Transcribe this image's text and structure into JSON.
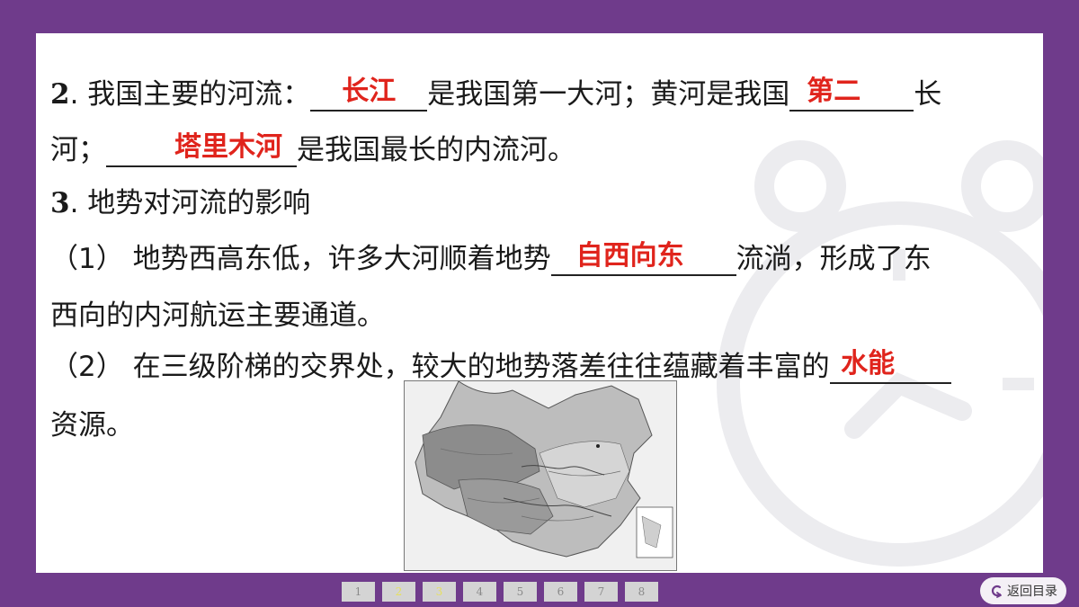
{
  "q2": {
    "num": "2",
    "text1": ". 我国主要的河流：",
    "ans1": "长江",
    "text2": "是我国第一大河；黄河是我国",
    "ans2": "第二",
    "text3": "长",
    "text4": "河；",
    "ans3": "塔里木河",
    "text5": "是我国最长的内流河。"
  },
  "q3": {
    "num": "3",
    "title": ". 地势对河流的影响",
    "p1_label": "（1）",
    "p1_text1": "地势西高东低，许多大河顺着地势",
    "p1_ans": "自西向东",
    "p1_text2": "流淌，形成了东",
    "p1_text3": "西向的内河航运主要通道。",
    "p2_label": "（2）",
    "p2_text1": "在三级阶梯的交界处，较大的地势落差往往蕴藏着丰富的",
    "p2_ans": "水能",
    "p2_text2": "资源。"
  },
  "pagination": {
    "pages": [
      "1",
      "2",
      "3",
      "4",
      "5",
      "6",
      "7",
      "8"
    ],
    "active": [
      "2",
      "3"
    ]
  },
  "nav": {
    "back_label": "返回目录"
  },
  "colors": {
    "frame": "#6f3b8b",
    "answer": "#e0241c"
  }
}
